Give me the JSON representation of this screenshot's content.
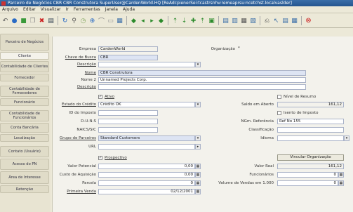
{
  "window": {
    "title": "Parceiro de Negócios  CBR  CBR Construtora  SuperUser@CardenWorld.HQ  [ReAdcpienerSei:tcastrsnhv:remeaprsu:ncetchst.localvaslder]"
  },
  "menu": [
    "Arquivo",
    "Editar",
    "Visualizar",
    "Ir",
    "Ferramentas",
    "Janela",
    "Ajuda"
  ],
  "toolbar_icons": [
    "undo-icon",
    "help-icon",
    "new-icon",
    "copy-icon",
    "delete-icon",
    "print-icon",
    "refresh-icon",
    "find-icon",
    "history-icon",
    "zoom-icon",
    "attach-icon",
    "chat-icon",
    "grid-icon",
    "first-icon",
    "prev-icon",
    "next-icon",
    "last-icon",
    "parent-icon",
    "detail-icon",
    "report-icon",
    "archive-icon",
    "product-icon",
    "request-icon",
    "workflow-icon",
    "exit-icon"
  ],
  "tabs": [
    {
      "label": "Parceiro de Negócios",
      "selected": false
    },
    {
      "label": "Cliente",
      "selected": true
    },
    {
      "label": "Contabilidade de Clientes",
      "selected": false
    },
    {
      "label": "Fornecedor",
      "selected": false
    },
    {
      "label": "Contabilidade de Fornecedores",
      "selected": false
    },
    {
      "label": "Funcionário",
      "selected": false
    },
    {
      "label": "Contabilidade de Funcionários",
      "selected": false
    },
    {
      "label": "Conta Bancária",
      "selected": false
    },
    {
      "label": "Localização",
      "selected": false
    },
    {
      "label": "Contato (Usuário)",
      "selected": false
    },
    {
      "label": "Acesso do PN",
      "selected": false
    },
    {
      "label": "Área de Interesse",
      "selected": false
    },
    {
      "label": "Retenção",
      "selected": false
    }
  ],
  "form": {
    "empresa": {
      "label": "Empresa",
      "value": "CardenWorld"
    },
    "organizacao": {
      "label": "Organização",
      "value": "*"
    },
    "chave": {
      "label": "Chave de Busca",
      "value": "CBR"
    },
    "descricao1": {
      "label": "Descrição",
      "value": ""
    },
    "nome": {
      "label": "Nome",
      "value": "CBR Construtora"
    },
    "nome2": {
      "label": "Nome 2",
      "value": "Unnamed Projects Corp."
    },
    "descricao2": {
      "label": "Descrição",
      "value": ""
    },
    "ativo": {
      "label": "Ativo",
      "checked": true
    },
    "nivel_resumo": {
      "label": "Nível de Resumo",
      "checked": false
    },
    "estado_credito": {
      "label": "Estado do Crédito",
      "value": "Crédito OK"
    },
    "saldo_aberto": {
      "label": "Saldo em Aberto",
      "value": "161,12"
    },
    "id_imposto": {
      "label": "ID do Imposto",
      "value": ""
    },
    "isento": {
      "label": "Isento de Imposto",
      "checked": false
    },
    "dun": {
      "label": "D-U-N-S",
      "value": ""
    },
    "ngm": {
      "label": "NGm. Referência",
      "value": "Ref No 155"
    },
    "naics": {
      "label": "NAICS/SIC",
      "value": ""
    },
    "classificacao": {
      "label": "Classificação",
      "value": ""
    },
    "grupo": {
      "label": "Grupo de Parceiros",
      "value": "Standard Customers"
    },
    "idioma": {
      "label": "Idioma",
      "value": ""
    },
    "url": {
      "label": "URL",
      "value": ""
    },
    "prospectivo": {
      "label": "Prospectivo",
      "checked": true
    },
    "verificar_org": {
      "label": "Vincular Organização"
    },
    "valor_potencial": {
      "label": "Valor Potencial",
      "value": "0,00"
    },
    "valor_real": {
      "label": "Valor Real",
      "value": "161,12"
    },
    "custo_aquisicao": {
      "label": "Custo de Aquisição",
      "value": "0,00"
    },
    "funcionarios": {
      "label": "Funcionários",
      "value": "0"
    },
    "parcela": {
      "label": "Parcela",
      "value": "0"
    },
    "volume_vendas": {
      "label": "Volume de Vendas em 1.000",
      "value": "0"
    },
    "primeira_venda": {
      "label": "Primeira Venda",
      "value": "02/12/2001"
    }
  }
}
